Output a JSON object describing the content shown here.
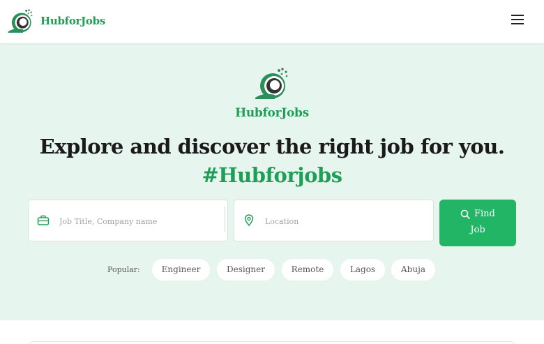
{
  "brand": {
    "name": "HubforJobs"
  },
  "nav": {
    "menu_icon": "hamburger-menu-icon"
  },
  "hero": {
    "brand_name": "HubforJobs",
    "headline": "Explore and discover the right job for you.",
    "hashtag": "#Hubforjobs"
  },
  "search": {
    "job_placeholder": "Job Title, Company name",
    "job_value": "",
    "job_icon": "briefcase-icon",
    "location_placeholder": "Location",
    "location_value": "",
    "location_icon": "location-pin-icon",
    "button_label_line1": "Find",
    "button_label_line2": "Job",
    "button_icon": "search-icon"
  },
  "popular": {
    "label": "Popular:",
    "tags": [
      "Engineer",
      "Designer",
      "Remote",
      "Lagos",
      "Abuja"
    ]
  },
  "colors": {
    "brand_green": "#1f9e57",
    "button_green": "#22b566",
    "hero_background": "#e6f5ee"
  }
}
